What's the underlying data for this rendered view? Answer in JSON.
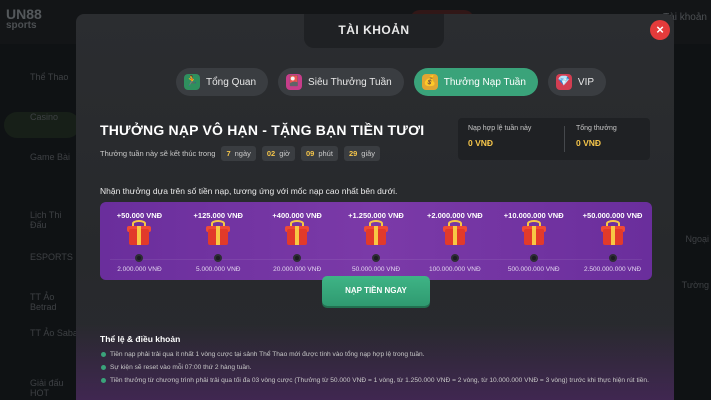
{
  "background": {
    "logo_line1": "UN88",
    "logo_line2": "sports",
    "top_right": "Tài khoản",
    "sidebar": [
      {
        "label": "Thể Thao"
      },
      {
        "label": "Casino"
      },
      {
        "label": "Game Bài"
      },
      {
        "label": "Lịch Thi Đấu"
      },
      {
        "label": "ESPORTS"
      },
      {
        "label": "TT Ảo Betrad"
      },
      {
        "label": "TT Ảo Saba"
      },
      {
        "label": "Giải đấu HOT"
      }
    ],
    "right_items": [
      "Ngoại",
      "Tường"
    ]
  },
  "modal": {
    "title": "TÀI KHOẢN",
    "close_icon": "×",
    "tabs": [
      {
        "label": "Tổng Quan",
        "icon": "runner-icon",
        "glyph": "🏃",
        "active": false
      },
      {
        "label": "Siêu Thưởng Tuần",
        "icon": "cards-icon",
        "glyph": "🎴",
        "active": false
      },
      {
        "label": "Thưởng Nạp Tuần",
        "icon": "bag-icon",
        "glyph": "💰",
        "active": true
      },
      {
        "label": "VIP",
        "icon": "gem-icon",
        "glyph": "💎",
        "active": false
      }
    ],
    "headline": "THƯỞNG NẠP VÔ HẠN - TẶNG BẠN TIỀN TƯƠI",
    "timer": {
      "label": "Thưởng tuần này sẽ kết thúc trong",
      "days_value": "7",
      "days_unit": "ngày",
      "hours_value": "02",
      "hours_unit": "giờ",
      "minutes_value": "09",
      "minutes_unit": "phút",
      "seconds_value": "29",
      "seconds_unit": "giây"
    },
    "stats": {
      "valid_deposit_label": "Nạp hợp lệ tuần này",
      "valid_deposit_value": "0 VNĐ",
      "total_bonus_label": "Tổng thưởng",
      "total_bonus_value": "0 VNĐ"
    },
    "description": "Nhận thưởng dựa trên số tiền nạp, tương ứng với mốc nạp cao nhất bên dưới.",
    "rewards": [
      {
        "bonus": "+50.000 VNĐ",
        "threshold": "2.000.000 VNĐ"
      },
      {
        "bonus": "+125.000 VNĐ",
        "threshold": "5.000.000 VNĐ"
      },
      {
        "bonus": "+400.000 VNĐ",
        "threshold": "20.000.000 VNĐ"
      },
      {
        "bonus": "+1.250.000 VNĐ",
        "threshold": "50.000.000 VNĐ"
      },
      {
        "bonus": "+2.000.000 VNĐ",
        "threshold": "100.000.000 VNĐ"
      },
      {
        "bonus": "+10.000.000 VNĐ",
        "threshold": "500.000.000 VNĐ"
      },
      {
        "bonus": "+50.000.000 VNĐ",
        "threshold": "2.500.000.000 VNĐ"
      }
    ],
    "deposit_button": "NẠP TIỀN NGAY",
    "terms_title": "Thể lệ & điều khoản",
    "terms": [
      "Tiền nạp phải trải qua ít nhất 1 vòng cược tại sảnh Thể Thao mới được tính vào tổng nạp hợp lệ trong tuần.",
      "Sự kiện sẽ reset vào mỗi 07:00 thứ 2 hàng tuần.",
      "Tiền thưởng từ chương trình phải trải qua tối đa 03 vòng cược (Thưởng từ 50.000 VNĐ = 1 vòng, từ 1.250.000 VNĐ = 2 vòng, từ 10.000.000 VNĐ = 3 vòng) trước khi thực hiện rút tiền."
    ]
  }
}
